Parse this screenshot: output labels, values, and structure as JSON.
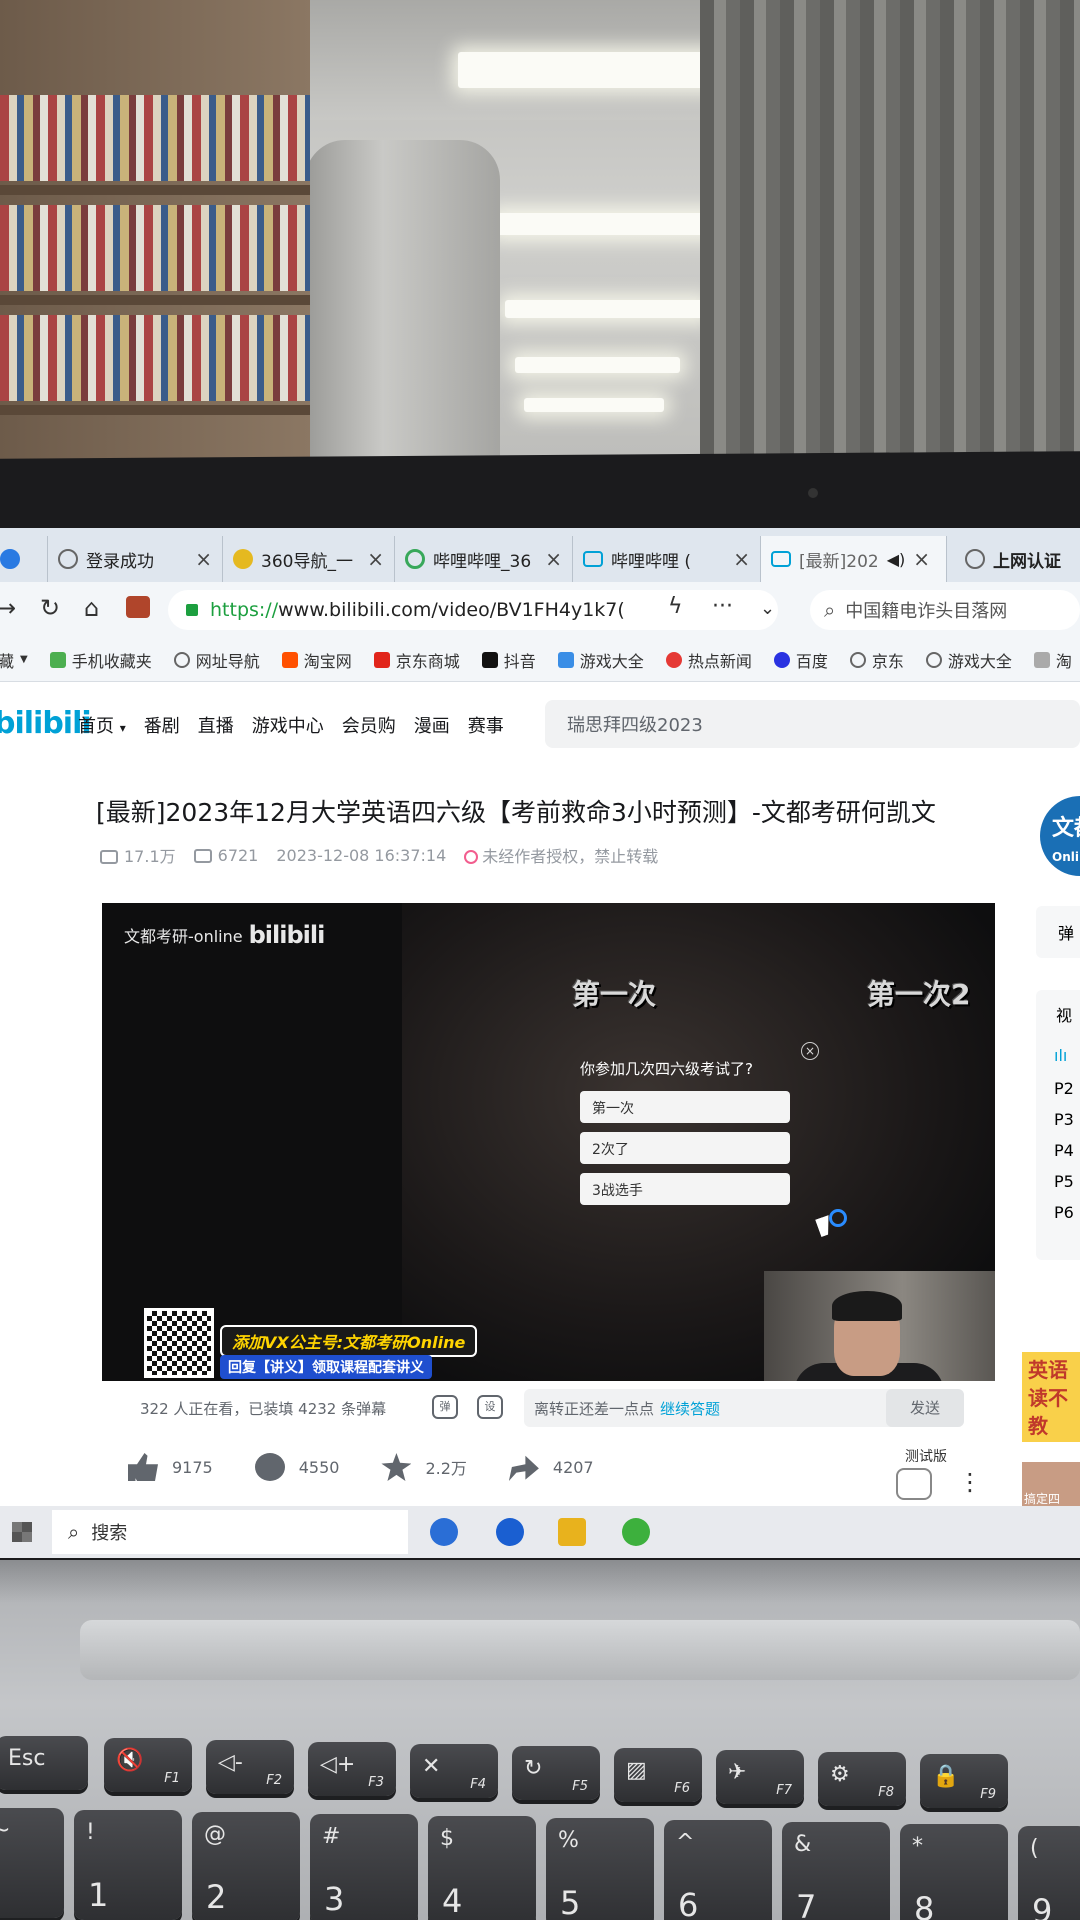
{
  "browser": {
    "tabs": [
      {
        "label": "登录成功",
        "icon": "globe-icon"
      },
      {
        "label": "360导航_一",
        "icon": "360-icon"
      },
      {
        "label": "哔哩哔哩_36",
        "icon": "360-browser-icon"
      },
      {
        "label": "哔哩哔哩 (",
        "icon": "bilibili-icon"
      },
      {
        "label": "[最新]202",
        "icon": "bilibili-icon",
        "active": true
      },
      {
        "label": "上网认证",
        "icon": "globe-icon"
      }
    ],
    "url_https": "https://",
    "url_rest": "www.bilibili.com/video/BV1FH4y1k7(",
    "search_placeholder": "中国籍电诈头目落网",
    "bookmarks": [
      "藏",
      "手机收藏夹",
      "网址导航",
      "淘宝网",
      "京东商城",
      "抖音",
      "游戏大全",
      "热点新闻",
      "百度",
      "京东",
      "游戏大全",
      "淘"
    ]
  },
  "site": {
    "logo": "bilibili",
    "nav": [
      "首页",
      "番剧",
      "直播",
      "游戏中心",
      "会员购",
      "漫画",
      "赛事"
    ],
    "search_value": "瑞思拜四级2023"
  },
  "video": {
    "title": "[最新]2023年12月大学英语四六级【考前救命3小时预测】-文都考研何凯文",
    "views": "17.1万",
    "danmaku_count": "6721",
    "datetime": "2023-12-08 16:37:14",
    "copyright": "未经作者授权，禁止转载",
    "uploader_avatar_text": "文都",
    "uploader_avatar_sub": "Online"
  },
  "player": {
    "watermark_text": "文都考研-online",
    "watermark_logo": "bilibili",
    "danmaku": [
      "第一次",
      "第一次2"
    ],
    "quiz_question": "你参加几次四六级考试了?",
    "quiz_options": [
      "第一次",
      "2次了",
      "3战选手"
    ],
    "quiz_close": "×",
    "promo_line1": "添加VX公主号:文都考研Online",
    "promo_line2": "回复【讲义】领取课程配套讲义"
  },
  "danmaku_bar": {
    "watching": "322 人正在看，已装填 4232 条弹幕",
    "input_text": "离转正还差一点点",
    "input_link": "继续答题",
    "send": "发送",
    "toggle_label": "弹",
    "settings_label": "设"
  },
  "actions": {
    "like": "9175",
    "coin": "4550",
    "favorite": "2.2万",
    "share": "4207",
    "test_tag": "测试版"
  },
  "sidebar": {
    "danmaku_label": "弹",
    "video_label": "视",
    "parts": [
      "P2",
      "P3",
      "P4",
      "P5",
      "P6"
    ],
    "ad_text": "英语 读不 教",
    "ad2_text": "搞定四"
  },
  "taskbar": {
    "search": "搜索"
  },
  "keyboard": {
    "keys": [
      "Esc",
      "F1",
      "F2",
      "F3",
      "F4",
      "F5",
      "F6",
      "F7",
      "F8",
      "F9",
      "!",
      "@",
      "#",
      "$",
      "%",
      "^",
      "&",
      "*",
      "(",
      "1",
      "2",
      "3",
      "4",
      "5",
      "6",
      "7",
      "8",
      "9"
    ]
  }
}
